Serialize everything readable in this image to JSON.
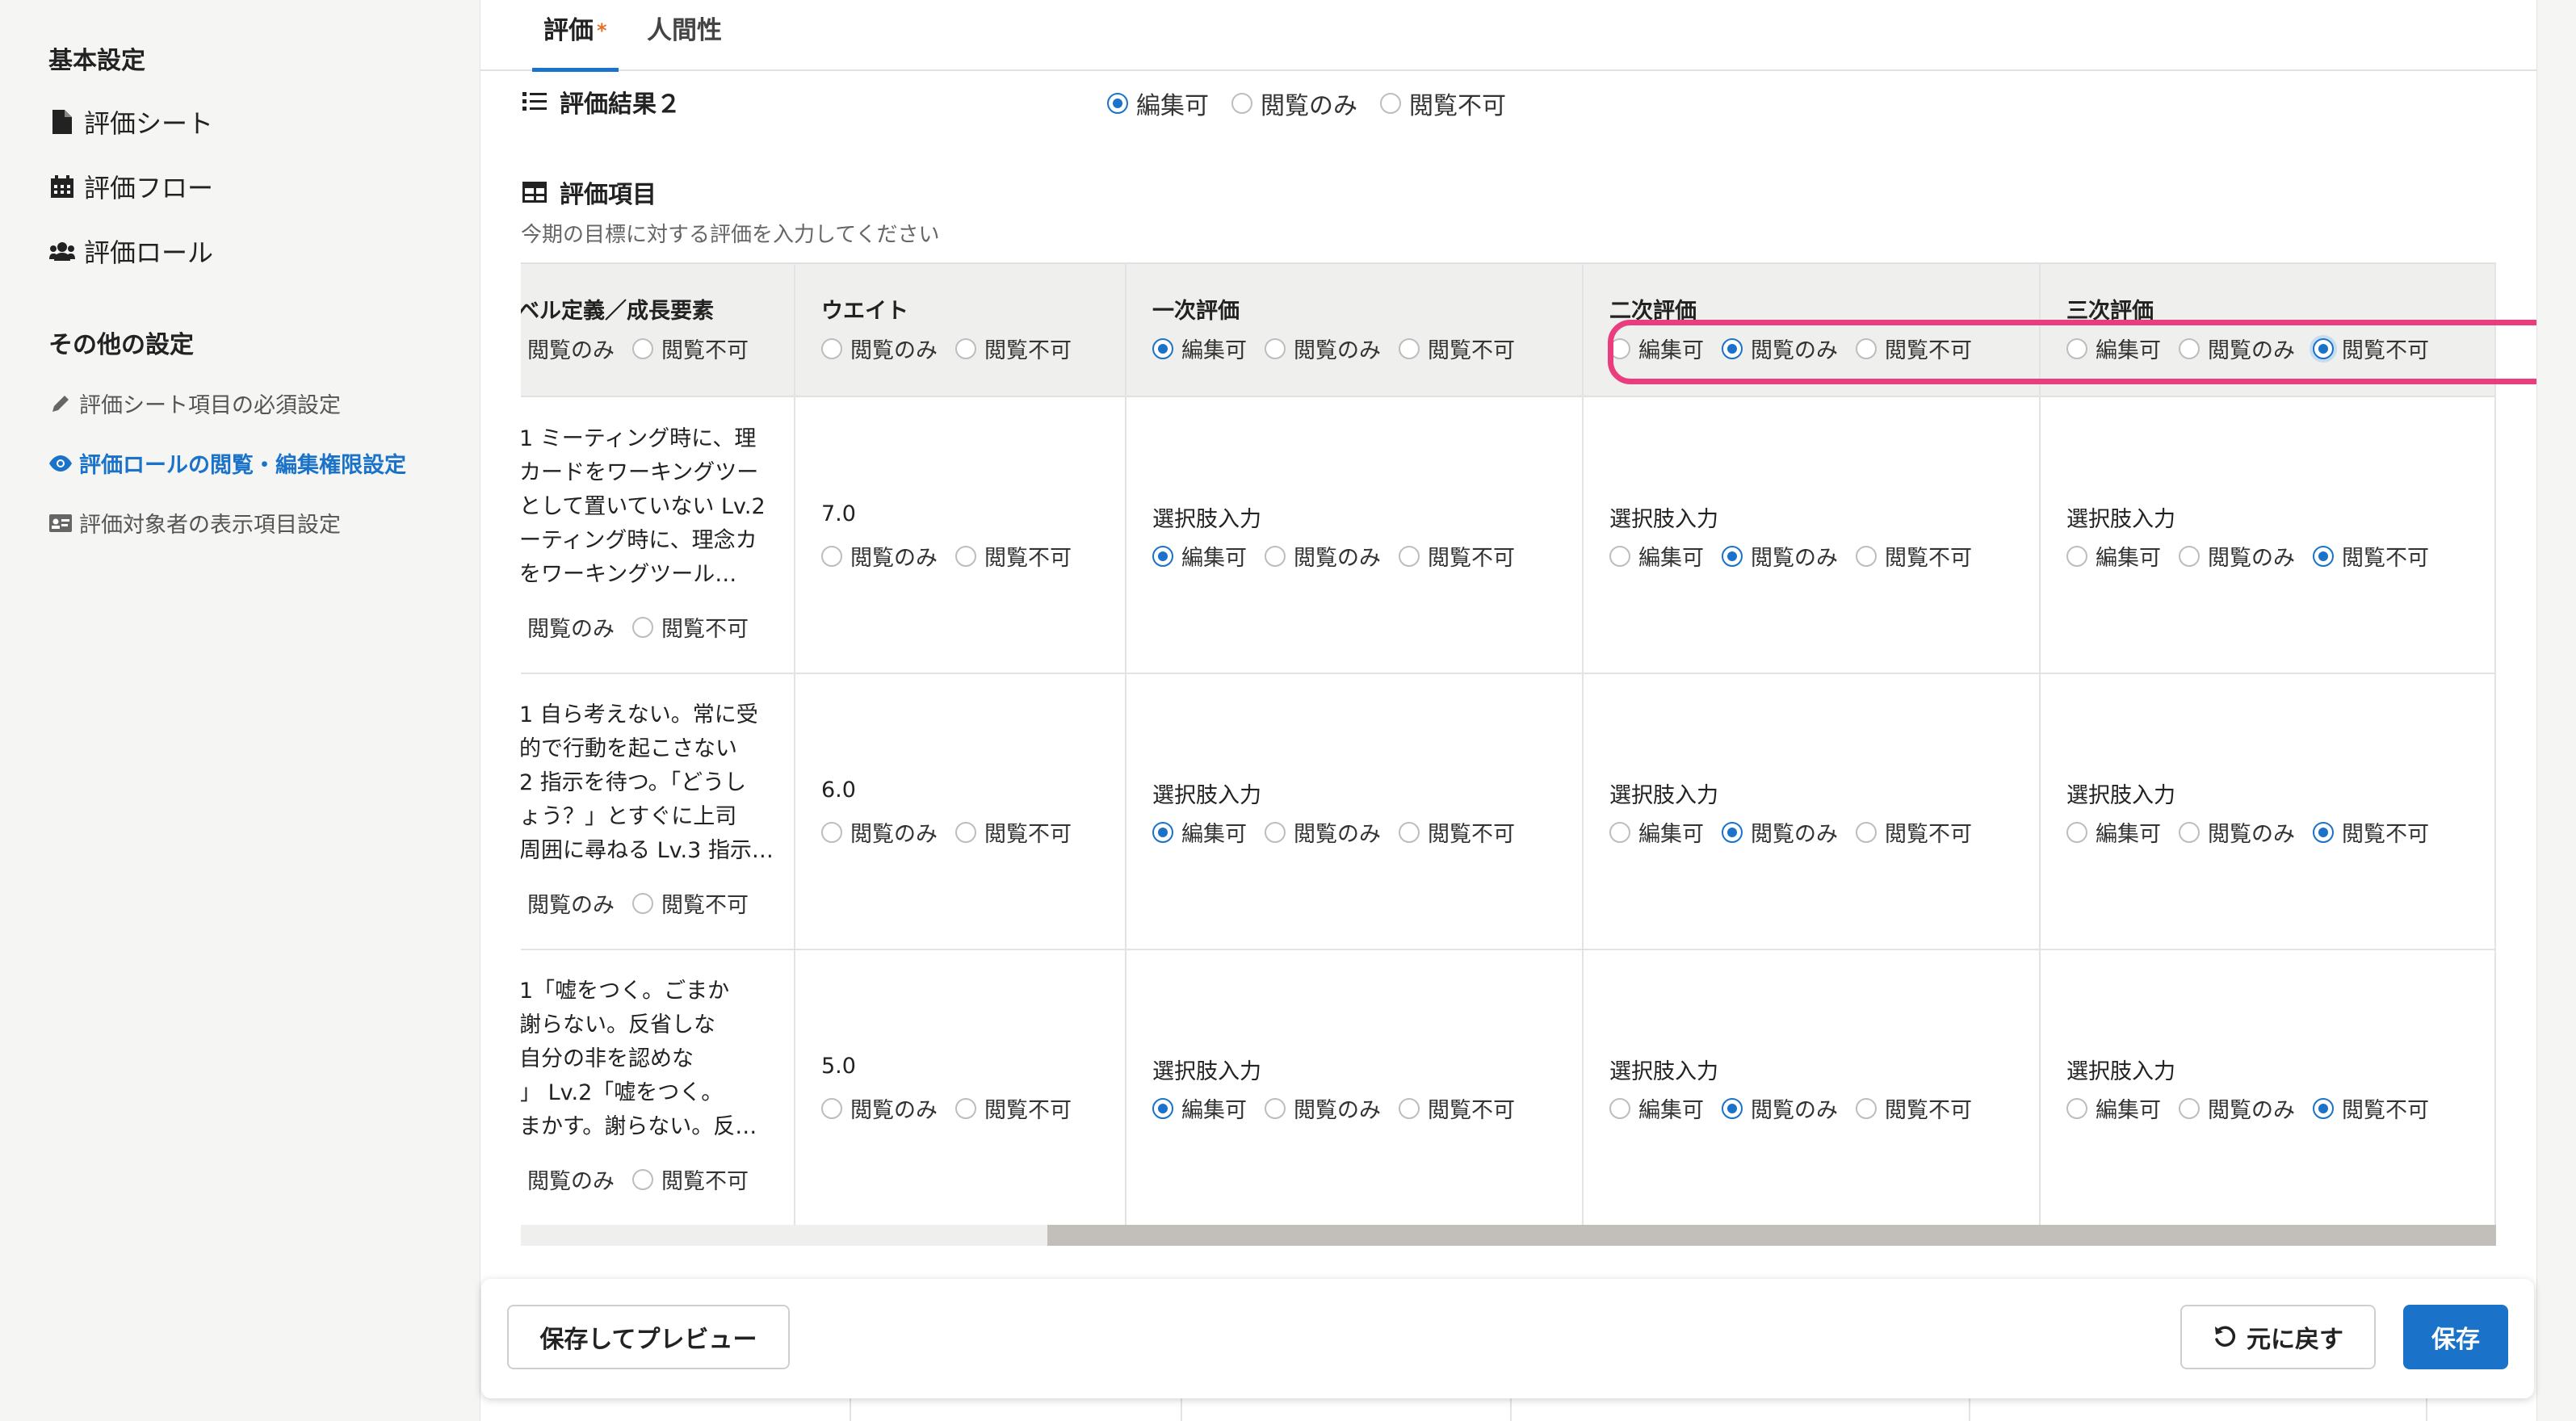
{
  "sidebar": {
    "basic_heading": "基本設定",
    "basic_items": [
      {
        "label": "評価シート",
        "icon": "file-icon"
      },
      {
        "label": "評価フロー",
        "icon": "calendar-icon"
      },
      {
        "label": "評価ロール",
        "icon": "users-icon"
      }
    ],
    "other_heading": "その他の設定",
    "other_items": [
      {
        "label": "評価シート項目の必須設定",
        "icon": "pencil-icon"
      },
      {
        "label": "評価ロールの閲覧・編集権限設定",
        "icon": "eye-icon",
        "active": true
      },
      {
        "label": "評価対象者の表示項目設定",
        "icon": "id-card-icon"
      }
    ]
  },
  "tabs": [
    {
      "label": "評価",
      "required_mark": "*",
      "active": true
    },
    {
      "label": "人間性",
      "active": false
    }
  ],
  "result2": {
    "title": "評価結果２",
    "options": [
      "編集可",
      "閲覧のみ",
      "閲覧不可"
    ],
    "selected": "編集可"
  },
  "items": {
    "title": "評価項目",
    "description": "今期の目標に対する評価を入力してください"
  },
  "table": {
    "columns": [
      {
        "title": "ベル定義／成長要素",
        "options": [
          "閲覧のみ",
          "閲覧不可"
        ]
      },
      {
        "title": "ウエイト",
        "options": [
          "閲覧のみ",
          "閲覧不可"
        ]
      },
      {
        "title": "一次評価",
        "options": [
          "編集可",
          "閲覧のみ",
          "閲覧不可"
        ],
        "selected": "編集可"
      },
      {
        "title": "二次評価",
        "options": [
          "編集可",
          "閲覧のみ",
          "閲覧不可"
        ],
        "selected": "閲覧のみ"
      },
      {
        "title": "三次評価",
        "options": [
          "編集可",
          "閲覧のみ",
          "閲覧不可"
        ],
        "selected": "閲覧不可"
      }
    ],
    "rows": [
      {
        "definition": "1 ミーティング時に、理\nカードをワーキングツー\nとして置いていない Lv.2\nーティング時に、理念カ\nをワーキングツール…",
        "weight": "7.0",
        "input_label": "選択肢入力"
      },
      {
        "definition": "1 自ら考えない。常に受\n的で行動を起こさない\n2 指示を待つ。「どうし\nょう？」とすぐに上司\n周囲に尋ねる Lv.3 指示…",
        "weight": "6.0",
        "input_label": "選択肢入力"
      },
      {
        "definition": "1「嘘をつく。ごまか\n謝らない。反省しな\n自分の非を認めな\n」 Lv.2「嘘をつく。\nまかす。謝らない。反…",
        "weight": "5.0",
        "input_label": "選択肢入力"
      }
    ],
    "row_selection": {
      "primary": "編集可",
      "secondary": "閲覧のみ",
      "tertiary": "閲覧不可"
    }
  },
  "footer": {
    "preview_button": "保存してプレビュー",
    "revert_button": "元に戻す",
    "save_button": "保存"
  },
  "colors": {
    "accent": "#1a73c8",
    "highlight": "#ea3d7e",
    "required_star": "#e0762d"
  }
}
